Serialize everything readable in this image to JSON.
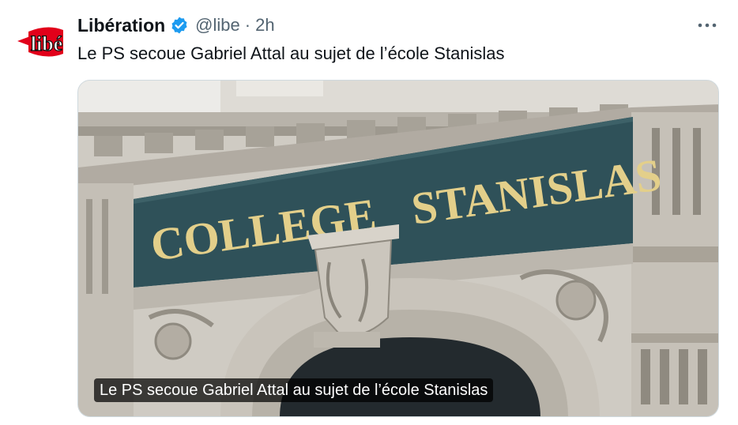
{
  "tweet": {
    "author_name": "Libération",
    "handle": "@libe",
    "separator": "·",
    "time": "2h",
    "text": "Le PS secoue Gabriel Attal au sujet de l’école Stanislas",
    "avatar_logo": "Libé",
    "verified_icon": "verified-badge-icon",
    "more_icon": "more-options-icon"
  },
  "media": {
    "caption": "Le PS secoue Gabriel Attal au sujet de l’école Stanislas",
    "sign_left": "COLLEGE",
    "sign_right": "STANISLAS"
  },
  "colors": {
    "verified_blue": "#1d9bf0",
    "logo_red": "#e2001a",
    "sign_blue": "#2f5159",
    "sign_gold": "#e3cf8a"
  }
}
